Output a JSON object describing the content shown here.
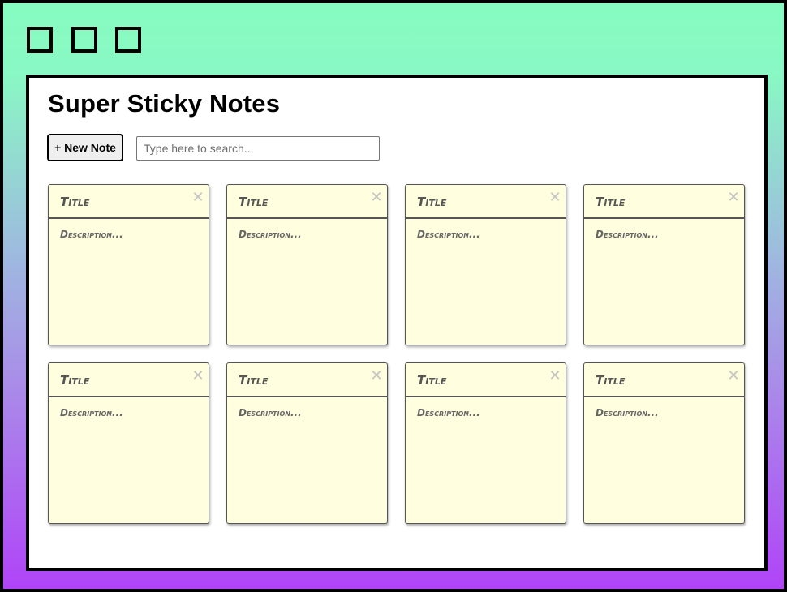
{
  "window_controls": {
    "buttons": [
      "square-button-1",
      "square-button-2",
      "square-button-3"
    ]
  },
  "app": {
    "title": "Super Sticky Notes",
    "new_note_label": "+ New Note",
    "search": {
      "placeholder": "Type here to search...",
      "value": ""
    }
  },
  "notes": [
    {
      "title": "Title",
      "description": "Description...",
      "close": "✕"
    },
    {
      "title": "Title",
      "description": "Description...",
      "close": "✕"
    },
    {
      "title": "Title",
      "description": "Description...",
      "close": "✕"
    },
    {
      "title": "Title",
      "description": "Description...",
      "close": "✕"
    },
    {
      "title": "Title",
      "description": "Description...",
      "close": "✕"
    },
    {
      "title": "Title",
      "description": "Description...",
      "close": "✕"
    },
    {
      "title": "Title",
      "description": "Description...",
      "close": "✕"
    },
    {
      "title": "Title",
      "description": "Description...",
      "close": "✕"
    }
  ],
  "colors": {
    "gradient_top": "#86fcc0",
    "gradient_bottom": "#b044f8",
    "note_background": "#fffedf",
    "note_border": "#555555",
    "close_icon": "#c4c4c4"
  }
}
